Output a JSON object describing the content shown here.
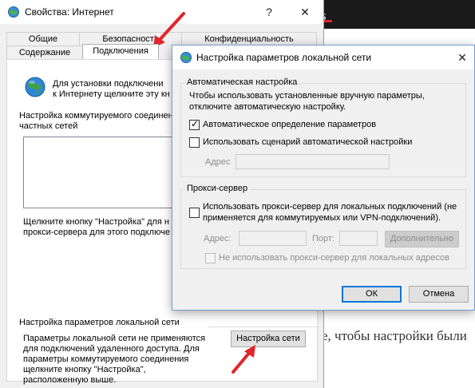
{
  "background": {
    "header_fragment": "s",
    "article_fragment": "е, чтобы настройки были"
  },
  "main_window": {
    "title": "Свойства: Интернет",
    "help_glyph": "?",
    "close_glyph": "✕",
    "tabs_back": [
      "Общие",
      "Безопасность",
      "Конфиденциальность"
    ],
    "tabs_front": [
      "Содержание",
      "Подключения"
    ],
    "active_tab": "Подключения",
    "setup_text_1": "Для установки подключени",
    "setup_text_2": "к Интернету щелкните эту кн",
    "dialup_label_1": "Настройка коммутируемого соединен",
    "dialup_label_2": "частных сетей",
    "proxy_hint_1": "Щелкните кнопку \"Настройка\" для н",
    "proxy_hint_2": "прокси-сервера для этого подключе",
    "lan_section_label": "Настройка параметров локальной сети",
    "lan_note_1": "Параметры локальной сети не применяются",
    "lan_note_2": "для подключений удаленного доступа. Для",
    "lan_note_3": "параметры коммутируемого соединения",
    "lan_note_4": "щелкните кнопку \"Настройка\",",
    "lan_note_5": "расположенную выше.",
    "lan_settings_button": "Настройка сети"
  },
  "lan_dialog": {
    "title": "Настройка параметров локальной сети",
    "close_glyph": "✕",
    "auto_group": {
      "legend": "Автоматическая настройка",
      "note_1": "Чтобы использовать установленные вручную параметры,",
      "note_2": "отключите автоматическую настройку.",
      "auto_detect_label": "Автоматическое определение параметров",
      "auto_detect_checked": true,
      "script_label": "Использовать сценарий автоматической настройки",
      "script_checked": false,
      "address_label": "Адрес",
      "address_value": ""
    },
    "proxy_group": {
      "legend": "Прокси-сервер",
      "use_proxy_label_1": "Использовать прокси-сервер для локальных подключений (не",
      "use_proxy_label_2": "применяется для коммутируемых или VPN-подключений).",
      "use_proxy_checked": false,
      "address_label": "Адрес:",
      "address_value": "",
      "port_label": "Порт:",
      "port_value": "",
      "advanced_button": "Дополнительно",
      "bypass_label": "Не использовать прокси-сервер для локальных адресов",
      "bypass_checked": false
    },
    "ok_button": "ОК",
    "cancel_button": "Отмена"
  },
  "colors": {
    "annotation_arrow": "#e0252b",
    "focus_border": "#0078d7"
  }
}
